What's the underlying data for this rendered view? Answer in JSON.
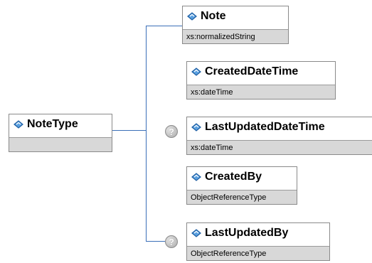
{
  "root": {
    "name": "NoteType",
    "type": ""
  },
  "children": [
    {
      "name": "Note",
      "type": "xs:normalizedString",
      "optional": false
    },
    {
      "name": "CreatedDateTime",
      "type": "xs:dateTime",
      "optional": false
    },
    {
      "name": "LastUpdatedDateTime",
      "type": "xs:dateTime",
      "optional": true,
      "marker": "?"
    },
    {
      "name": "CreatedBy",
      "type": "ObjectReferenceType",
      "optional": false
    },
    {
      "name": "LastUpdatedBy",
      "type": "ObjectReferenceType",
      "optional": true,
      "marker": "?"
    }
  ],
  "colors": {
    "line": "#3a6fb8",
    "icon_fill": "#5aa0e0",
    "icon_stroke": "#1f5fa3",
    "type_bar": "#d8d8d8",
    "border": "#8a8a8a"
  },
  "icons": {
    "element": "element-diamond-icon",
    "optional": "optional-question-icon"
  }
}
